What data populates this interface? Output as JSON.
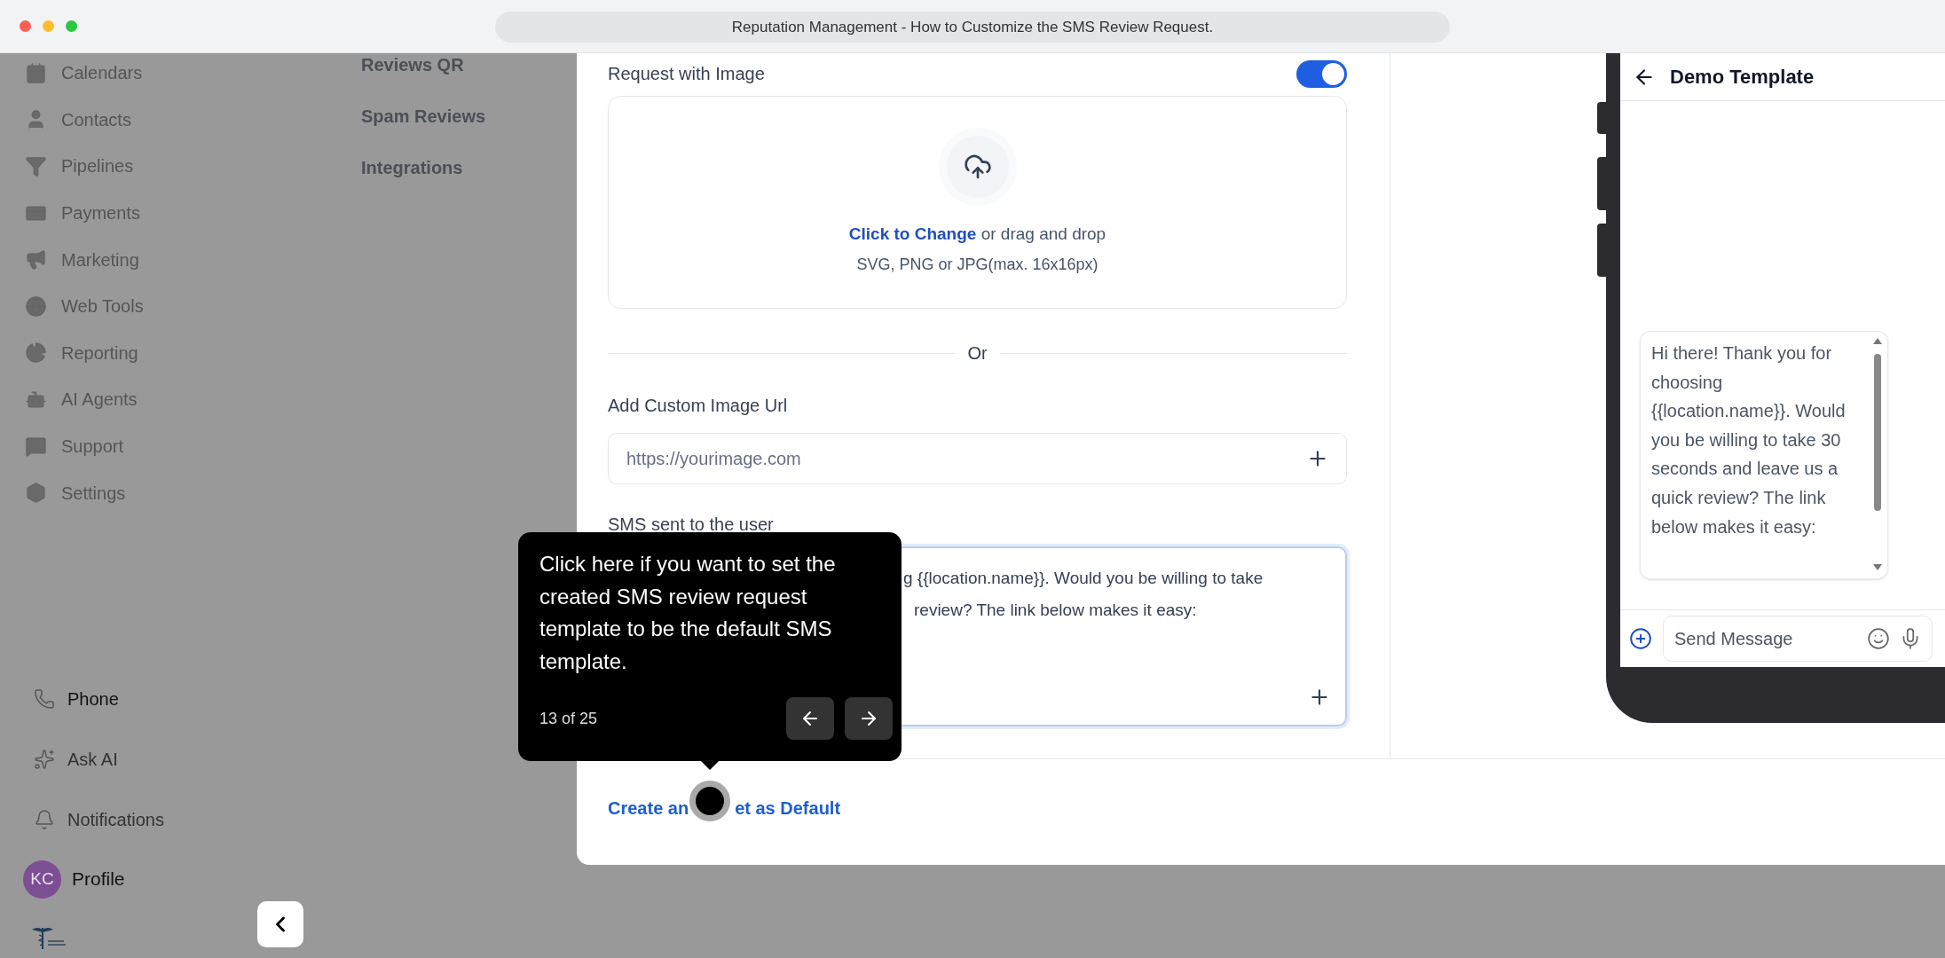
{
  "window": {
    "title": "Reputation Management - How to Customize the SMS Review Request."
  },
  "sidebar": {
    "items": [
      "Calendars",
      "Contacts",
      "Pipelines",
      "Payments",
      "Marketing",
      "Web Tools",
      "Reporting",
      "AI Agents",
      "Support",
      "Settings"
    ],
    "bottom_items": [
      "Phone",
      "Ask AI",
      "Notifications"
    ],
    "profile": {
      "initials": "KC",
      "label": "Profile"
    }
  },
  "subnav": {
    "items": [
      "Reviews QR",
      "Spam Reviews",
      "Integrations"
    ]
  },
  "form": {
    "request_with_image": {
      "label": "Request with Image",
      "on": true
    },
    "upload": {
      "link": "Click to Change",
      "text": "or drag and drop",
      "hint": "SVG, PNG or JPG(max. 16x16px)"
    },
    "separator": "Or",
    "custom_url": {
      "label": "Add Custom Image Url",
      "placeholder": "https://yourimage.com"
    },
    "sms": {
      "label": "SMS sent to the user",
      "lines": [
        "g {{location.name}}. Would you be willing to take",
        "review? The link below makes it easy:"
      ]
    },
    "submit": [
      "Create an",
      "et as Default"
    ]
  },
  "preview": {
    "title": "Demo Template",
    "message": "Hi there! Thank you for choosing {{location.name}}. Would you be willing to take 30 seconds and leave us a quick review? The link below makes it easy:",
    "input_placeholder": "Send Message"
  },
  "tour": {
    "text": "Click here if you want to set the created SMS review request template to be the default SMS template.",
    "step": "13 of 25"
  }
}
